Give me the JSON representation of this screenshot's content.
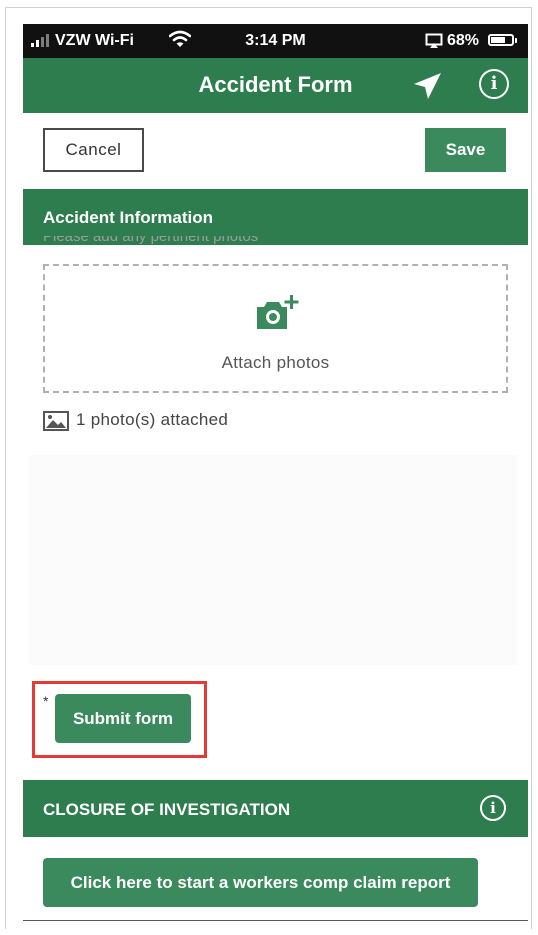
{
  "status_bar": {
    "carrier": "VZW Wi-Fi",
    "time": "3:14 PM",
    "battery_percent": "68%",
    "battery_level": 0.68,
    "icons": [
      "signal-icon",
      "wifi-icon",
      "screen-mirror-icon",
      "battery-icon"
    ]
  },
  "header": {
    "title": "Accident Form",
    "icons": [
      "location-arrow-icon",
      "info-icon"
    ]
  },
  "toolbar": {
    "cancel_label": "Cancel",
    "save_label": "Save"
  },
  "accident_section": {
    "title": "Accident Information",
    "partial_prompt": "Please add any pertinent photos",
    "attach_label": "Attach photos",
    "attached_status": "1 photo(s) attached"
  },
  "submit": {
    "required_marker": "*",
    "label": "Submit form"
  },
  "closure_section": {
    "title": "CLOSURE OF INVESTIGATION",
    "claim_button_label": "Click here to start a workers comp claim report"
  },
  "colors": {
    "brand_green": "#2e7d4f",
    "button_green": "#3a8a5d",
    "highlight_red": "#e53935"
  }
}
